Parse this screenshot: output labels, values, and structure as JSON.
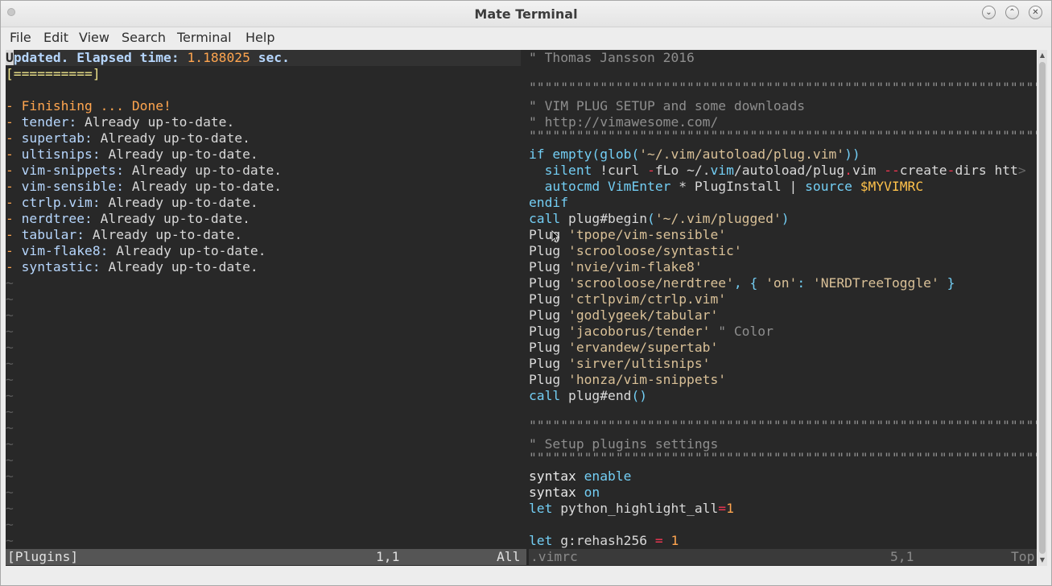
{
  "window": {
    "title": "Mate Terminal",
    "min_glyph": "⌄",
    "max_glyph": "⌃",
    "close_glyph": "✕"
  },
  "menu": {
    "items": [
      "File",
      "Edit",
      "View",
      "Search",
      "Terminal",
      "Help"
    ]
  },
  "left_pane": {
    "header": {
      "cursor_char": "U",
      "label": "pdated. Elapsed time: ",
      "time": "1.188025",
      "unit": " sec."
    },
    "progress": "[==========]",
    "finishing": "- Finishing ... Done!",
    "plugins": [
      {
        "name": "tender",
        "status": "Already up-to-date."
      },
      {
        "name": "supertab",
        "status": "Already up-to-date."
      },
      {
        "name": "ultisnips",
        "status": "Already up-to-date."
      },
      {
        "name": "vim-snippets",
        "status": "Already up-to-date."
      },
      {
        "name": "vim-sensible",
        "status": "Already up-to-date."
      },
      {
        "name": "ctrlp.vim",
        "status": "Already up-to-date."
      },
      {
        "name": "nerdtree",
        "status": "Already up-to-date."
      },
      {
        "name": "tabular",
        "status": "Already up-to-date."
      },
      {
        "name": "vim-flake8",
        "status": "Already up-to-date."
      },
      {
        "name": "syntastic",
        "status": "Already up-to-date."
      }
    ],
    "tilde": "~",
    "status": {
      "name": "[Plugins]",
      "pos": "1,1",
      "pct": "All"
    }
  },
  "right_pane": {
    "c_author": "\" Thomas Jansson 2016",
    "c_rule": "\"\"\"\"\"\"\"\"\"\"\"\"\"\"\"\"\"\"\"\"\"\"\"\"\"\"\"\"\"\"\"\"\"\"\"\"\"\"\"\"\"\"\"\"\"\"\"\"\"\"\"\"\"\"\"\"\"\"\"\"\"\"\"\"\"\"\"\"\"\"",
    "c_setup": "\" VIM PLUG SETUP and some downloads",
    "c_url": "\" http://vimawesome.com/",
    "c_plugset": "\" Setup plugins settings",
    "if_kw": "if ",
    "if_fn": "empty(glob(",
    "if_str": "'~/.vim/autoload/plug.vim'",
    "if_close": "))",
    "silent_kw": "  silent ",
    "curl": "!curl ",
    "flag_dash": "-",
    "curl_rest": "fLo ~/.",
    "vim_word": "vim",
    "autoload_path": "/autoload/plug",
    "dot": ".",
    "plug_vim": "vim ",
    "dashdash": "--",
    "create": "create",
    "dirs": "dirs htt",
    "trunc": ">",
    "autocmd_kw": "  autocmd ",
    "vimenter": "VimEnter",
    "star": " * PlugInstall | ",
    "source_kw": "source ",
    "myvimrc": "$MYVIMRC",
    "endif": "endif",
    "call_kw": "call ",
    "begin_fn": "plug#begin",
    "begin_open": "(",
    "begin_str": "'~/.vim/plugged'",
    "begin_close": ")",
    "plug_kw": "Plug ",
    "plugs": [
      "'tpope/vim-sensible'",
      "'scrooloose/syntastic'",
      "'nvie/vim-flake8'",
      "'scrooloose/nerdtree'",
      "'ctrlpvim/ctrlp.vim'",
      "'godlygeek/tabular'",
      "'jacoborus/tender'",
      "'ervandew/supertab'",
      "'sirver/ultisnips'",
      "'honza/vim-snippets'"
    ],
    "nerd_opts_a": ", { ",
    "nerd_on": "'on'",
    "nerd_colon": ": ",
    "nerd_toggle": "'NERDTreeToggle'",
    "nerd_close": " }",
    "tender_comment": " \" Color",
    "end_fn": "plug#end",
    "end_paren": "()",
    "syntax_kw": "syntax ",
    "enable": "enable",
    "on": "on",
    "let_kw": "let ",
    "python_hl": "python_highlight_all",
    "eq": "=",
    "one": "1",
    "rehash": "g:rehash256 ",
    "eq_sp": "= ",
    "status": {
      "name": ".vimrc",
      "pos": "5,1",
      "pct": "Top"
    }
  },
  "scrollbar": {
    "up": "▲",
    "down": "▼"
  }
}
